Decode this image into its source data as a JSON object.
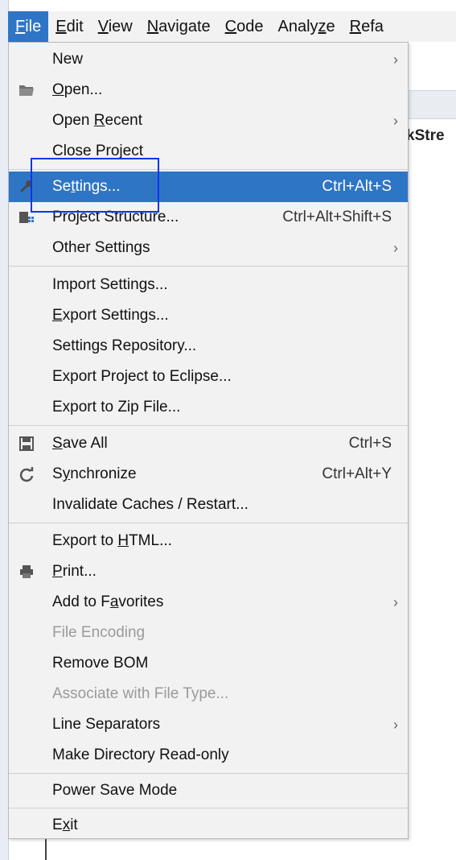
{
  "menubar": {
    "items": [
      {
        "label": "File"
      },
      {
        "label": "Edit"
      },
      {
        "label": "View"
      },
      {
        "label": "Navigate"
      },
      {
        "label": "Code"
      },
      {
        "label": "Analyze"
      },
      {
        "label": "Refa"
      }
    ]
  },
  "editor": {
    "tab_text": "kStre"
  },
  "file_menu": {
    "new": {
      "label": "New"
    },
    "open": {
      "label": "Open..."
    },
    "open_recent": {
      "label": "Open Recent"
    },
    "close_project": {
      "label": "Close Project"
    },
    "settings": {
      "label": "Settings...",
      "shortcut": "Ctrl+Alt+S"
    },
    "project_structure": {
      "label": "Project Structure...",
      "shortcut": "Ctrl+Alt+Shift+S"
    },
    "other_settings": {
      "label": "Other Settings"
    },
    "import_settings": {
      "label": "Import Settings..."
    },
    "export_settings": {
      "label": "Export Settings..."
    },
    "settings_repository": {
      "label": "Settings Repository..."
    },
    "export_eclipse": {
      "label": "Export Project to Eclipse..."
    },
    "export_zip": {
      "label": "Export to Zip File..."
    },
    "save_all": {
      "label": "Save All",
      "shortcut": "Ctrl+S"
    },
    "synchronize": {
      "label": "Synchronize",
      "shortcut": "Ctrl+Alt+Y"
    },
    "invalidate": {
      "label": "Invalidate Caches / Restart..."
    },
    "export_html": {
      "label": "Export to HTML..."
    },
    "print": {
      "label": "Print..."
    },
    "add_favorites": {
      "label": "Add to Favorites"
    },
    "file_encoding": {
      "label": "File Encoding"
    },
    "remove_bom": {
      "label": "Remove BOM"
    },
    "associate": {
      "label": "Associate with File Type..."
    },
    "line_separators": {
      "label": "Line Separators"
    },
    "make_readonly": {
      "label": "Make Directory Read-only"
    },
    "power_save": {
      "label": "Power Save Mode"
    },
    "exit": {
      "label": "Exit"
    }
  },
  "icons": {
    "submenu_arrow": "chevron-right-icon",
    "open": "folder-icon",
    "settings": "wrench-icon",
    "project_structure": "project-structure-icon",
    "save_all": "save-icon",
    "synchronize": "sync-icon",
    "print": "printer-icon"
  },
  "colors": {
    "accent": "#2f75c5",
    "highlight_box": "#1133ee",
    "menu_bg": "#f2f2f2",
    "disabled_text": "#9a9a9a"
  }
}
